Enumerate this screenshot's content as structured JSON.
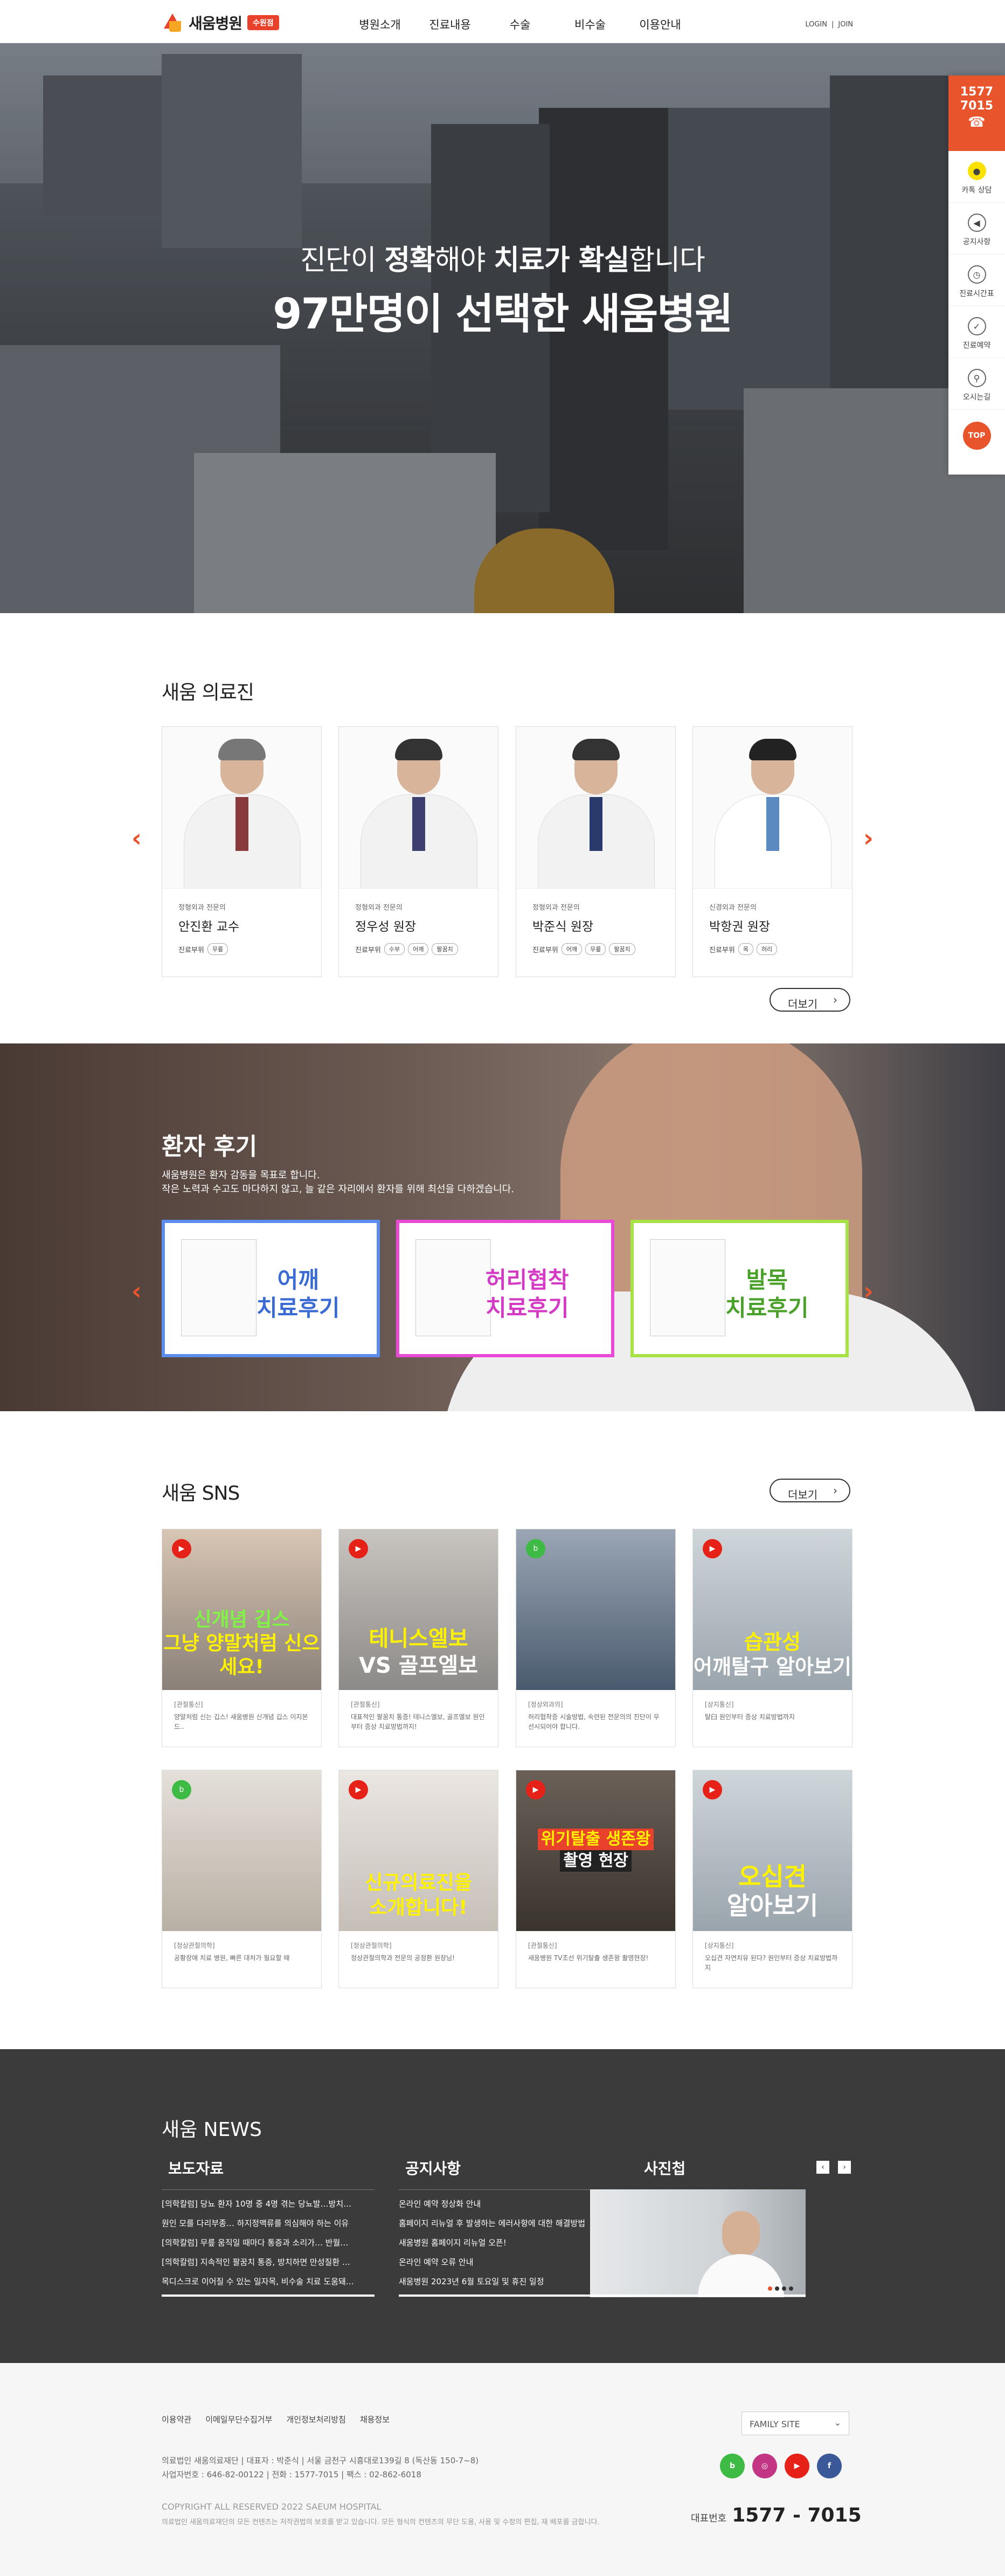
{
  "header": {
    "logo_text": "새움병원",
    "logo_badge": "수원점",
    "nav": [
      "병원소개",
      "진료내용",
      "수술",
      "비수술",
      "이용안내"
    ],
    "login": "LOGIN",
    "separator": "|",
    "join": "JOIN"
  },
  "hero": {
    "line1_a": "진단이 ",
    "line1_b": "정확",
    "line1_c": "해야 ",
    "line1_d": "치료가 확실",
    "line1_e": "합니다",
    "line2": "97만명이 선택한 새움병원"
  },
  "quick": {
    "phone1": "1577",
    "phone2": "7015",
    "items": [
      "카톡 상담",
      "공지사항",
      "진료시간표",
      "진료예약",
      "오시는길"
    ],
    "top": "TOP"
  },
  "doctors": {
    "title": "새움 의료진",
    "cards": [
      {
        "dept": "정형외과 전문의",
        "name": "안진환 교수",
        "label": "진료부위",
        "tags": [
          "무릎"
        ]
      },
      {
        "dept": "정형외과 전문의",
        "name": "정우성 원장",
        "label": "진료부위",
        "tags": [
          "수부",
          "어깨",
          "팔꿈치"
        ]
      },
      {
        "dept": "정형외과 전문의",
        "name": "박준식 원장",
        "label": "진료부위",
        "tags": [
          "어깨",
          "무릎",
          "팔꿈치"
        ]
      },
      {
        "dept": "신경외과 전문의",
        "name": "박항권 원장",
        "label": "진료부위",
        "tags": [
          "목",
          "허리"
        ]
      }
    ],
    "more": "더보기"
  },
  "review": {
    "title": "환자 후기",
    "desc1": "새움병원은 환자 감동을 목표로 합니다.",
    "desc2": "작은 노력과 수고도 마다하지 않고, 늘 같은 자리에서 환자를 위해 최선을 다하겠습니다.",
    "cards": [
      {
        "line1": "어깨",
        "line2": "치료후기",
        "color": "#5b8def",
        "text_color": "#3a6ad4"
      },
      {
        "line1": "허리협착",
        "line2": "치료후기",
        "color": "#e84ad6",
        "text_color": "#d43ac4"
      },
      {
        "line1": "발목",
        "line2": "치료후기",
        "color": "#a7e245",
        "text_color": "#4aa12a"
      }
    ]
  },
  "sns": {
    "title": "새움 SNS",
    "more": "더보기",
    "cards": [
      {
        "type": "youtube",
        "caption1": "신개념 깁스",
        "caption2": "그냥 양말처럼 신으세요!",
        "category": "[관절통신]",
        "text": "양말처럼 신는 깁스! 새움병원 신개념 깁스 이지본드.."
      },
      {
        "type": "youtube",
        "caption1": "테니스엘보",
        "caption2": "VS 골프엘보",
        "category": "[관절통신]",
        "text": "대표적인 팔꿈치 통증! 테니스엘보, 골프엘보 원인부터 증상 치료방법까지!"
      },
      {
        "type": "blog",
        "caption1": "",
        "caption2": "",
        "category": "[정상외과의]",
        "text": "허리협착증 시술방법, 숙련된 전문의의 진단이 우선시되어야 합니다."
      },
      {
        "type": "youtube",
        "caption1": "습관성",
        "caption2": "어깨탈구 알아보기",
        "category": "[상지통신]",
        "text": "탈臼 원인부터 증상 치료방법까지"
      },
      {
        "type": "blog",
        "caption1": "",
        "caption2": "",
        "category": "[정상관절의학]",
        "text": "공황장애 치료 병원, 빠른 대처가 필요할 때"
      },
      {
        "type": "youtube",
        "caption1": "신규의료진을",
        "caption2": "소개합니다!",
        "category": "[정상관절의학]",
        "text": "정상관절의학과 전문의 공정환 원장님!"
      },
      {
        "type": "youtube",
        "caption1": "위기탈출 생존왕",
        "caption2": "촬영 현장",
        "category": "[관절통신]",
        "text": "새움병원 TV조선 위기탈출 생존왕 촬영현장!"
      },
      {
        "type": "youtube",
        "caption1": "오십견",
        "caption2": "알아보기",
        "category": "[상지통신]",
        "text": "오십견 자연치유 된다? 원인부터 증상 치료방법까지"
      }
    ]
  },
  "news": {
    "title": "새움 NEWS",
    "press_title": "보도자료",
    "press": [
      "[의학칼럼] 당뇨 환자 10명 중 4명 겪는 당뇨발…방치…",
      "원인 모를 다리부종… 하지정맥류를 의심해야 하는 이유",
      "[의학칼럼] 무릎 움직일 때마다 통증과 소리가… 반월…",
      "[의학칼럼] 지속적인 팔꿈치 통증, 방치하면 만성질환 …",
      "목디스크로 이어질 수 있는 일자목, 비수술 치료 도움돼…"
    ],
    "notice_title": "공지사항",
    "notices": [
      "온라인 예약 정상화 안내",
      "홈페이지 리뉴얼 후 발생하는 에러사항에 대한 해결방법",
      "새움병원 홈페이지 리뉴얼 오픈!",
      "온라인 예약 오류 안내",
      "새움병원 2023년 6월 토요일 및 휴진 일정"
    ],
    "photo_title": "사진첩",
    "prev": "‹",
    "next": "›"
  },
  "footer": {
    "links": [
      "이용약관",
      "이메일무단수집거부",
      "개인정보처리방침",
      "채용정보"
    ],
    "info1": "의료법인 새움의료재단  |  대표자 : 박준식  |  서울 금천구 시흥대로139길 8 (독산동 150-7~8)",
    "info2": "사업자번호 : 646-82-00122  |  전화 : 1577-7015  |  팩스 : 02-862-6018",
    "copyright": "COPYRIGHT ALL RESERVED 2022 SAEUM HOSPITAL",
    "note": "의료법인 새움의료재단의 모든 컨텐츠는 저작권법의 보호를 받고 있습니다. 모든 형식의 컨텐츠의 무단 도용, 사용 및 수정의 편집, 재 배포를 금합니다.",
    "family_site": "FAMILY SITE",
    "tel_label": "대표번호",
    "tel": "1577 - 7015",
    "sns_icons": [
      "blog-icon",
      "instagram-icon",
      "youtube-icon",
      "facebook-icon"
    ]
  },
  "colors": {
    "accent": "#e8542c",
    "brand_red": "#e8412c",
    "brand_yellow": "#f5a623",
    "news_bg": "#3b3b3b",
    "footer_bg": "#f6f6f6"
  }
}
